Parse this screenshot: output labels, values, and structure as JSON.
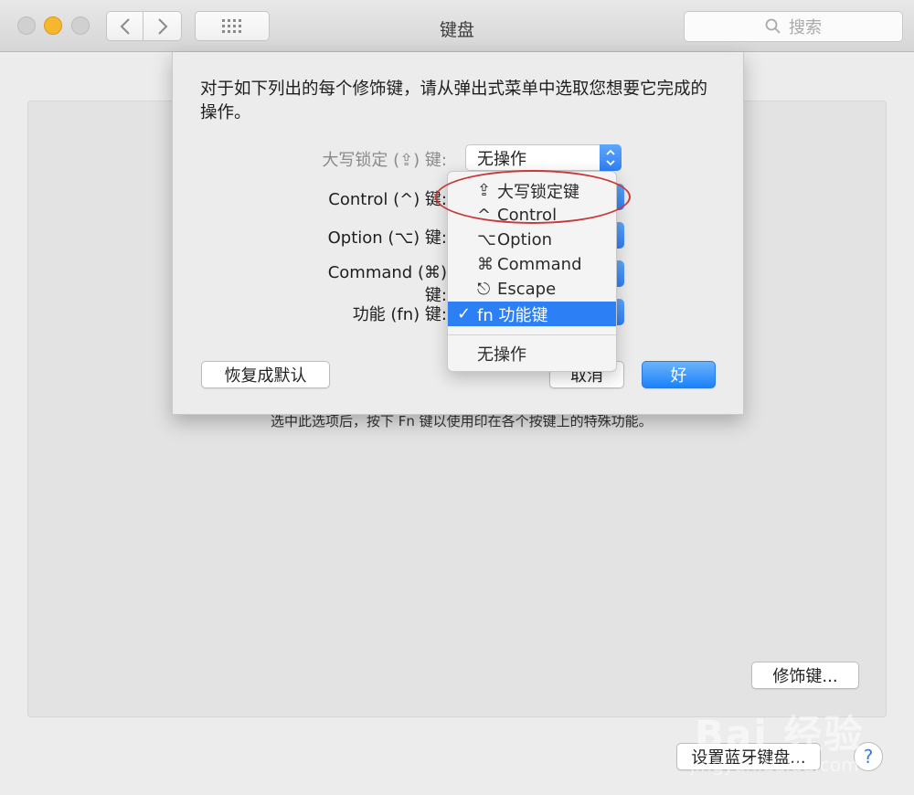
{
  "window": {
    "title": "键盘",
    "search_placeholder": "搜索",
    "back_icon": "chevron-left-icon",
    "forward_icon": "chevron-right-icon",
    "grid_icon": "grid-icon"
  },
  "background": {
    "fn_description": "选中此选项后，按下 Fn 键以使用印在各个按键上的特殊功能。",
    "modifier_button": "修饰键...",
    "bluetooth_button": "设置蓝牙键盘...",
    "help_button": "?"
  },
  "sheet": {
    "description": "对于如下列出的每个修饰键，请从弹出式菜单中选取您想要它完成的操作。",
    "rows": [
      {
        "label": "大写锁定 (⇪) 键:",
        "value": "无操作"
      },
      {
        "label": "Control (^) 键:"
      },
      {
        "label": "Option (⌥) 键:"
      },
      {
        "label": "Command (⌘) 键:"
      },
      {
        "label": "功能 (fn) 键:"
      }
    ],
    "reset_button": "恢复成默认",
    "cancel_button": "取消",
    "ok_button": "好"
  },
  "menu": {
    "items": [
      {
        "glyph": "⇪",
        "label": "大写锁定键"
      },
      {
        "glyph": "^",
        "label": "Control"
      },
      {
        "glyph": "⌥",
        "label": "Option"
      },
      {
        "glyph": "⌘",
        "label": "Command"
      },
      {
        "glyph": "⎋",
        "label": "Escape"
      },
      {
        "check": "✓",
        "label": "fn 功能键",
        "selected": true
      }
    ],
    "no_action": "无操作"
  },
  "watermark": {
    "text": "Bai 经验",
    "sub": "jingyan.baidu.com"
  },
  "colors": {
    "accent": "#2d7ff5",
    "annotation": "#c83a3a"
  }
}
